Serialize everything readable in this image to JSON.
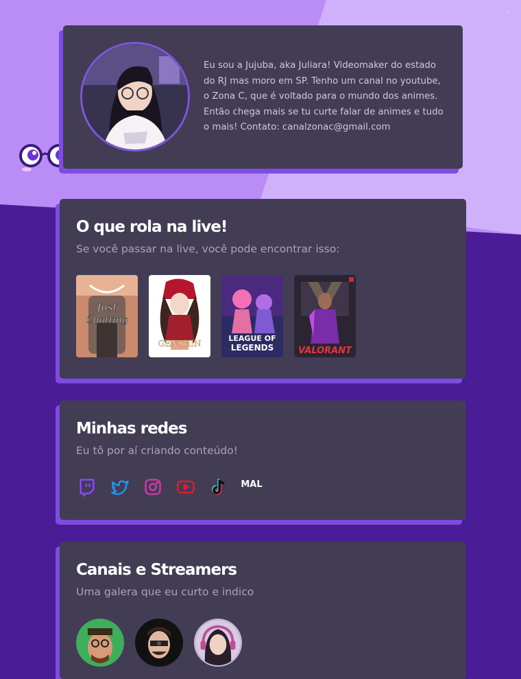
{
  "profile": {
    "bio": "Eu sou a Jujuba, aka Juliara! Videomaker do estado do RJ mas moro em SP. Tenho um canal no youtube, o Zona C, que é voltado para o mundo dos animes. Então chega mais se tu curte falar de animes e tudo o mais! Contato: canalzonac@gmail.com",
    "avatar_icon": "profile-avatar"
  },
  "live": {
    "title": "O que rola na live!",
    "subtitle": "Se você passar na live, você pode encontrar isso:",
    "games": [
      {
        "label_top": "Just",
        "label_bottom": "Chatting"
      },
      {
        "label_top": "GENSHIN",
        "label_bottom": "IMPACT"
      },
      {
        "label_top": "LEAGUE OF",
        "label_bottom": "LEGENDS"
      },
      {
        "label_top": "VALORANT",
        "label_bottom": ""
      }
    ]
  },
  "redes": {
    "title": "Minhas redes",
    "subtitle": "Eu tô por aí criando conteúdo!",
    "links": [
      {
        "icon": "twitch-icon",
        "color": "#9146ff"
      },
      {
        "icon": "twitter-icon",
        "color": "#1d9bf0"
      },
      {
        "icon": "instagram-icon",
        "color": "#d53ba8"
      },
      {
        "icon": "youtube-icon",
        "color": "#e11d2a"
      },
      {
        "icon": "tiktok-icon",
        "color": "#000000"
      },
      {
        "icon": "mal-icon",
        "label": "MAL",
        "color": "#ffffff"
      }
    ]
  },
  "canais": {
    "title": "Canais e Streamers",
    "subtitle": "Uma galera que eu curto e indico"
  },
  "colors": {
    "page_bg": "#4a1c96",
    "light_bg": "#b88af5",
    "card_bg": "#433c55",
    "accent": "#7d4ce0"
  }
}
